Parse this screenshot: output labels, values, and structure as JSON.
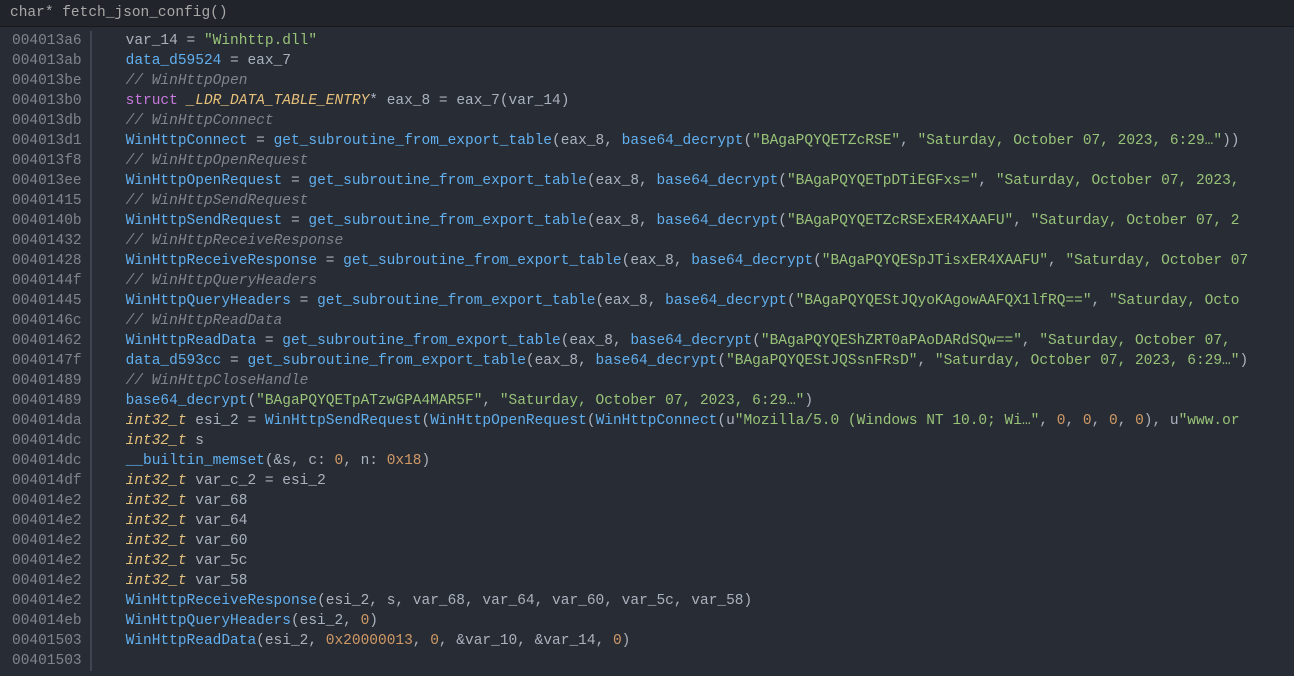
{
  "header": {
    "type": "char",
    "name": "fetch_json_config"
  },
  "addresses": [
    "004013a6",
    "004013ab",
    "004013be",
    "004013b0",
    "004013db",
    "004013d1",
    "004013f8",
    "004013ee",
    "00401415",
    "0040140b",
    "00401432",
    "00401428",
    "0040144f",
    "00401445",
    "0040146c",
    "00401462",
    "0040147f",
    "00401489",
    "00401489",
    "004014da",
    "004014dc",
    "004014dc",
    "004014df",
    "004014e2",
    "004014e2",
    "004014e2",
    "004014e2",
    "004014e2",
    "004014e2",
    "004014eb",
    "00401503",
    "00401503"
  ],
  "code": {
    "winhttp_dll": "\"Winhttp.dll\"",
    "data_d59524": "data_d59524",
    "eax7": "eax_7",
    "cmt_open": "// WinHttpOpen",
    "struct_kw": "struct",
    "ldr": "_LDR_DATA_TABLE_ENTRY",
    "eax8": "eax_8",
    "var14": "var_14",
    "cmt_connect": "// WinHttpConnect",
    "WinHttpConnect": "WinHttpConnect",
    "get_sub": "get_subroutine_from_export_table",
    "b64": "base64_decrypt",
    "s1": "\"BAgaPQYQETZcRSE\"",
    "date1": "\"Saturday, October 07, 2023, 6:29…\"",
    "cmt_openreq": "// WinHttpOpenRequest",
    "WinHttpOpenRequest": "WinHttpOpenRequest",
    "s2": "\"BAgaPQYQETpDTiEGFxs=\"",
    "date2": "\"Saturday, October 07, 2023,",
    "cmt_sendreq": "// WinHttpSendRequest",
    "WinHttpSendRequest": "WinHttpSendRequest",
    "s3": "\"BAgaPQYQETZcRSExER4XAAFU\"",
    "date3": "\"Saturday, October 07, 2",
    "cmt_recv": "// WinHttpReceiveResponse",
    "WinHttpReceiveResponse": "WinHttpReceiveResponse",
    "s4": "\"BAgaPQYQESpJTisxER4XAAFU\"",
    "date4": "\"Saturday, October 07",
    "cmt_qh": "// WinHttpQueryHeaders",
    "WinHttpQueryHeaders": "WinHttpQueryHeaders",
    "s5": "\"BAgaPQYQEStJQyoKAgowAAFQX1lfRQ==\"",
    "date5": "\"Saturday, Octo",
    "cmt_rd": "// WinHttpReadData",
    "WinHttpReadData": "WinHttpReadData",
    "s6": "\"BAgaPQYQEShZRT0aPAoDARdSQw==\"",
    "date6": "\"Saturday, October 07, ",
    "data_d593cc": "data_d593cc",
    "s7": "\"BAgaPQYQEStJQSsnFRsD\"",
    "date7": "\"Saturday, October 07, 2023, 6:29…\"",
    "cmt_close": "// WinHttpCloseHandle",
    "s8": "\"BAgaPQYQETpATzwGPA4MAR5F\"",
    "date8": "\"Saturday, October 07, 2023, 6:29…\"",
    "int32": "int32_t",
    "esi2": "esi_2",
    "mozilla": "\"Mozilla/5.0 (Windows NT 10.0; Wi…\"",
    "www": "\"www.or",
    "zero": "0",
    "memset": "__builtin_memset",
    "memset_c": "0",
    "memset_n": "0x18",
    "varc2": "var_c_2",
    "var68": "var_68",
    "var64": "var_64",
    "var60": "var_60",
    "var5c": "var_5c",
    "var58": "var_58",
    "hex2": "0x20000013",
    "var10": "var_10",
    "s_var": "s"
  }
}
